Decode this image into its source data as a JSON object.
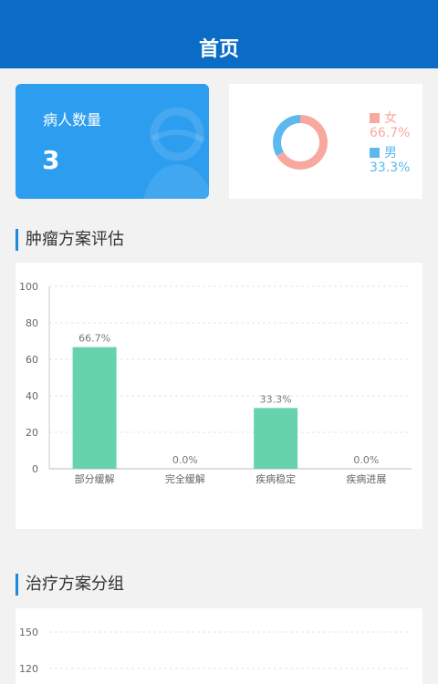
{
  "header": {
    "title": "首页"
  },
  "patients": {
    "label": "病人数量",
    "value": "3"
  },
  "gender": {
    "items": [
      {
        "label": "女",
        "percent": "66.7%",
        "fraction": 0.667,
        "color": "#f7a9a0"
      },
      {
        "label": "男",
        "percent": "33.3%",
        "fraction": 0.333,
        "color": "#5cb8ee"
      }
    ]
  },
  "sections": {
    "tumor_title": "肿瘤方案评估",
    "treatment_title": "治疗方案分组"
  },
  "chart_data": [
    {
      "type": "bar",
      "title": "",
      "categories": [
        "部分缓解",
        "完全缓解",
        "疾病稳定",
        "疾病进展"
      ],
      "values": [
        66.7,
        0.0,
        33.3,
        0.0
      ],
      "value_labels": [
        "66.7%",
        "0.0%",
        "33.3%",
        "0.0%"
      ],
      "ylim": [
        0,
        100
      ],
      "yticks": [
        0,
        20,
        40,
        60,
        80,
        100
      ],
      "color": "#66d3ad",
      "grid": true
    },
    {
      "type": "bar",
      "title": "",
      "categories": [],
      "values": [],
      "ylim": [
        120,
        150
      ],
      "yticks": [
        120,
        150
      ],
      "grid": true
    }
  ]
}
